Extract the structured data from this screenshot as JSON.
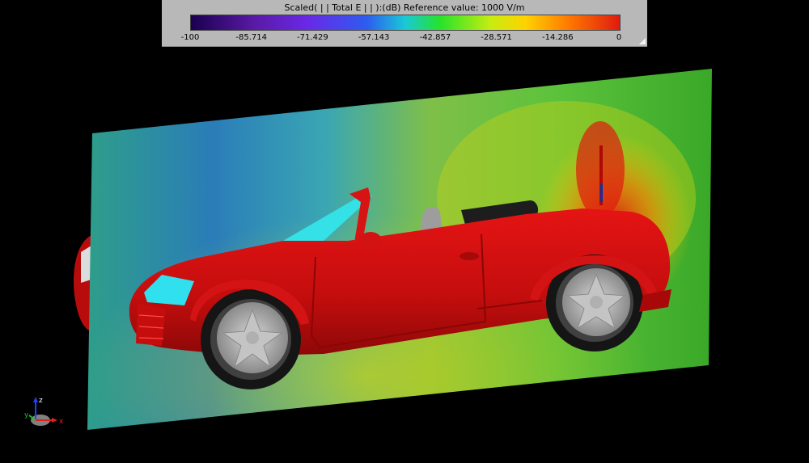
{
  "legend": {
    "title": "Scaled( | | Total E | | ):(dB) Reference value: 1000 V/m",
    "ticks": [
      "-100",
      "-85.714",
      "-71.429",
      "-57.143",
      "-42.857",
      "-28.571",
      "-14.286",
      "0"
    ],
    "colors": [
      "#1a0050",
      "#5a1aa6",
      "#6a28e6",
      "#2d5cf0",
      "#19c9d6",
      "#25e32b",
      "#c8ec10",
      "#ffd200",
      "#ff7a00",
      "#e01b10"
    ]
  },
  "axes": {
    "x_label": "x",
    "y_label": "y",
    "z_label": "z"
  }
}
